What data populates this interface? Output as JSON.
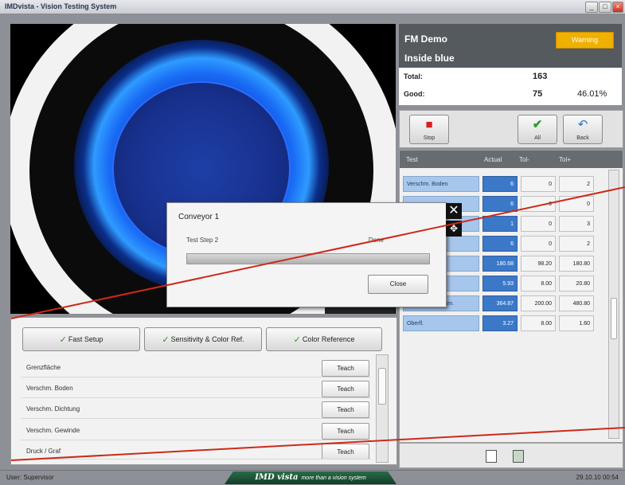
{
  "window": {
    "title": "IMDvista - Vision Testing System",
    "buttons": {
      "minimize": "_",
      "maximize": "□",
      "close": "×"
    }
  },
  "status": {
    "product": "FM Demo",
    "inspection": "Inside blue",
    "warning_label": "Warning",
    "total_label": "Total:",
    "total_value": "163",
    "good_label": "Good:",
    "good_value": "75",
    "good_percent": "46.01%"
  },
  "controls": {
    "stop_label": "Stop",
    "all_label": "All",
    "back_label": "Back",
    "stop_icon": "stop-icon",
    "all_icon": "check-icon",
    "back_icon": "back-arrow-icon"
  },
  "results": {
    "headers": {
      "test": "Test",
      "actual": "Actual",
      "tol_low": "Tol-",
      "tol_high": "Tol+"
    },
    "rows": [
      {
        "test": "Verschm. Boden",
        "actual": "6",
        "tol_low": "0",
        "tol_high": "2"
      },
      {
        "test": "",
        "actual": "6",
        "tol_low": "0",
        "tol_high": "0"
      },
      {
        "test": "",
        "actual": "1",
        "tol_low": "0",
        "tol_high": "3"
      },
      {
        "test": "",
        "actual": "6",
        "tol_low": "0",
        "tol_high": "2"
      },
      {
        "test": "",
        "actual": "180.68",
        "tol_low": "98.20",
        "tol_high": "180.80"
      },
      {
        "test": "",
        "actual": "5.93",
        "tol_low": "8.00",
        "tol_high": "20.80"
      },
      {
        "test": "Schichtm. Durchm.",
        "actual": "364.87",
        "tol_low": "200.00",
        "tol_high": "480.80"
      },
      {
        "test": "Oberfl.",
        "actual": "3.27",
        "tol_low": "8.00",
        "tol_high": "1.60"
      }
    ]
  },
  "setup": {
    "tabs": {
      "fast_setup": "Fast Setup",
      "sensitivity": "Sensitivity & Color Ref.",
      "color_reference": "Color Reference"
    },
    "items": [
      {
        "name": "Grenzfläche",
        "action": "Teach"
      },
      {
        "name": "Verschm. Boden",
        "action": "Teach"
      },
      {
        "name": "Verschm. Dichtung",
        "action": "Teach"
      },
      {
        "name": "Verschm. Gewinde",
        "action": "Teach"
      },
      {
        "name": "Druck / Graf",
        "action": "Teach"
      }
    ]
  },
  "dialog": {
    "title": "Conveyor 1",
    "step_label": "Test Step 2",
    "state_label": "Done",
    "progress": 1.0,
    "close_label": "Close",
    "close_glyph": "✕",
    "move_glyph": "✥"
  },
  "footer": {
    "user": "User: Supervisor",
    "logo_brand": "IMD vista",
    "logo_tagline": "more than a vision system",
    "datetime": "29.10.10 00:54"
  },
  "colors": {
    "accent_blue": "#3b78c8",
    "cell_blue": "#a7c6ec",
    "warning": "#f0b000",
    "header_dark": "#555a5f",
    "overlay_line": "#cc2a1a"
  }
}
